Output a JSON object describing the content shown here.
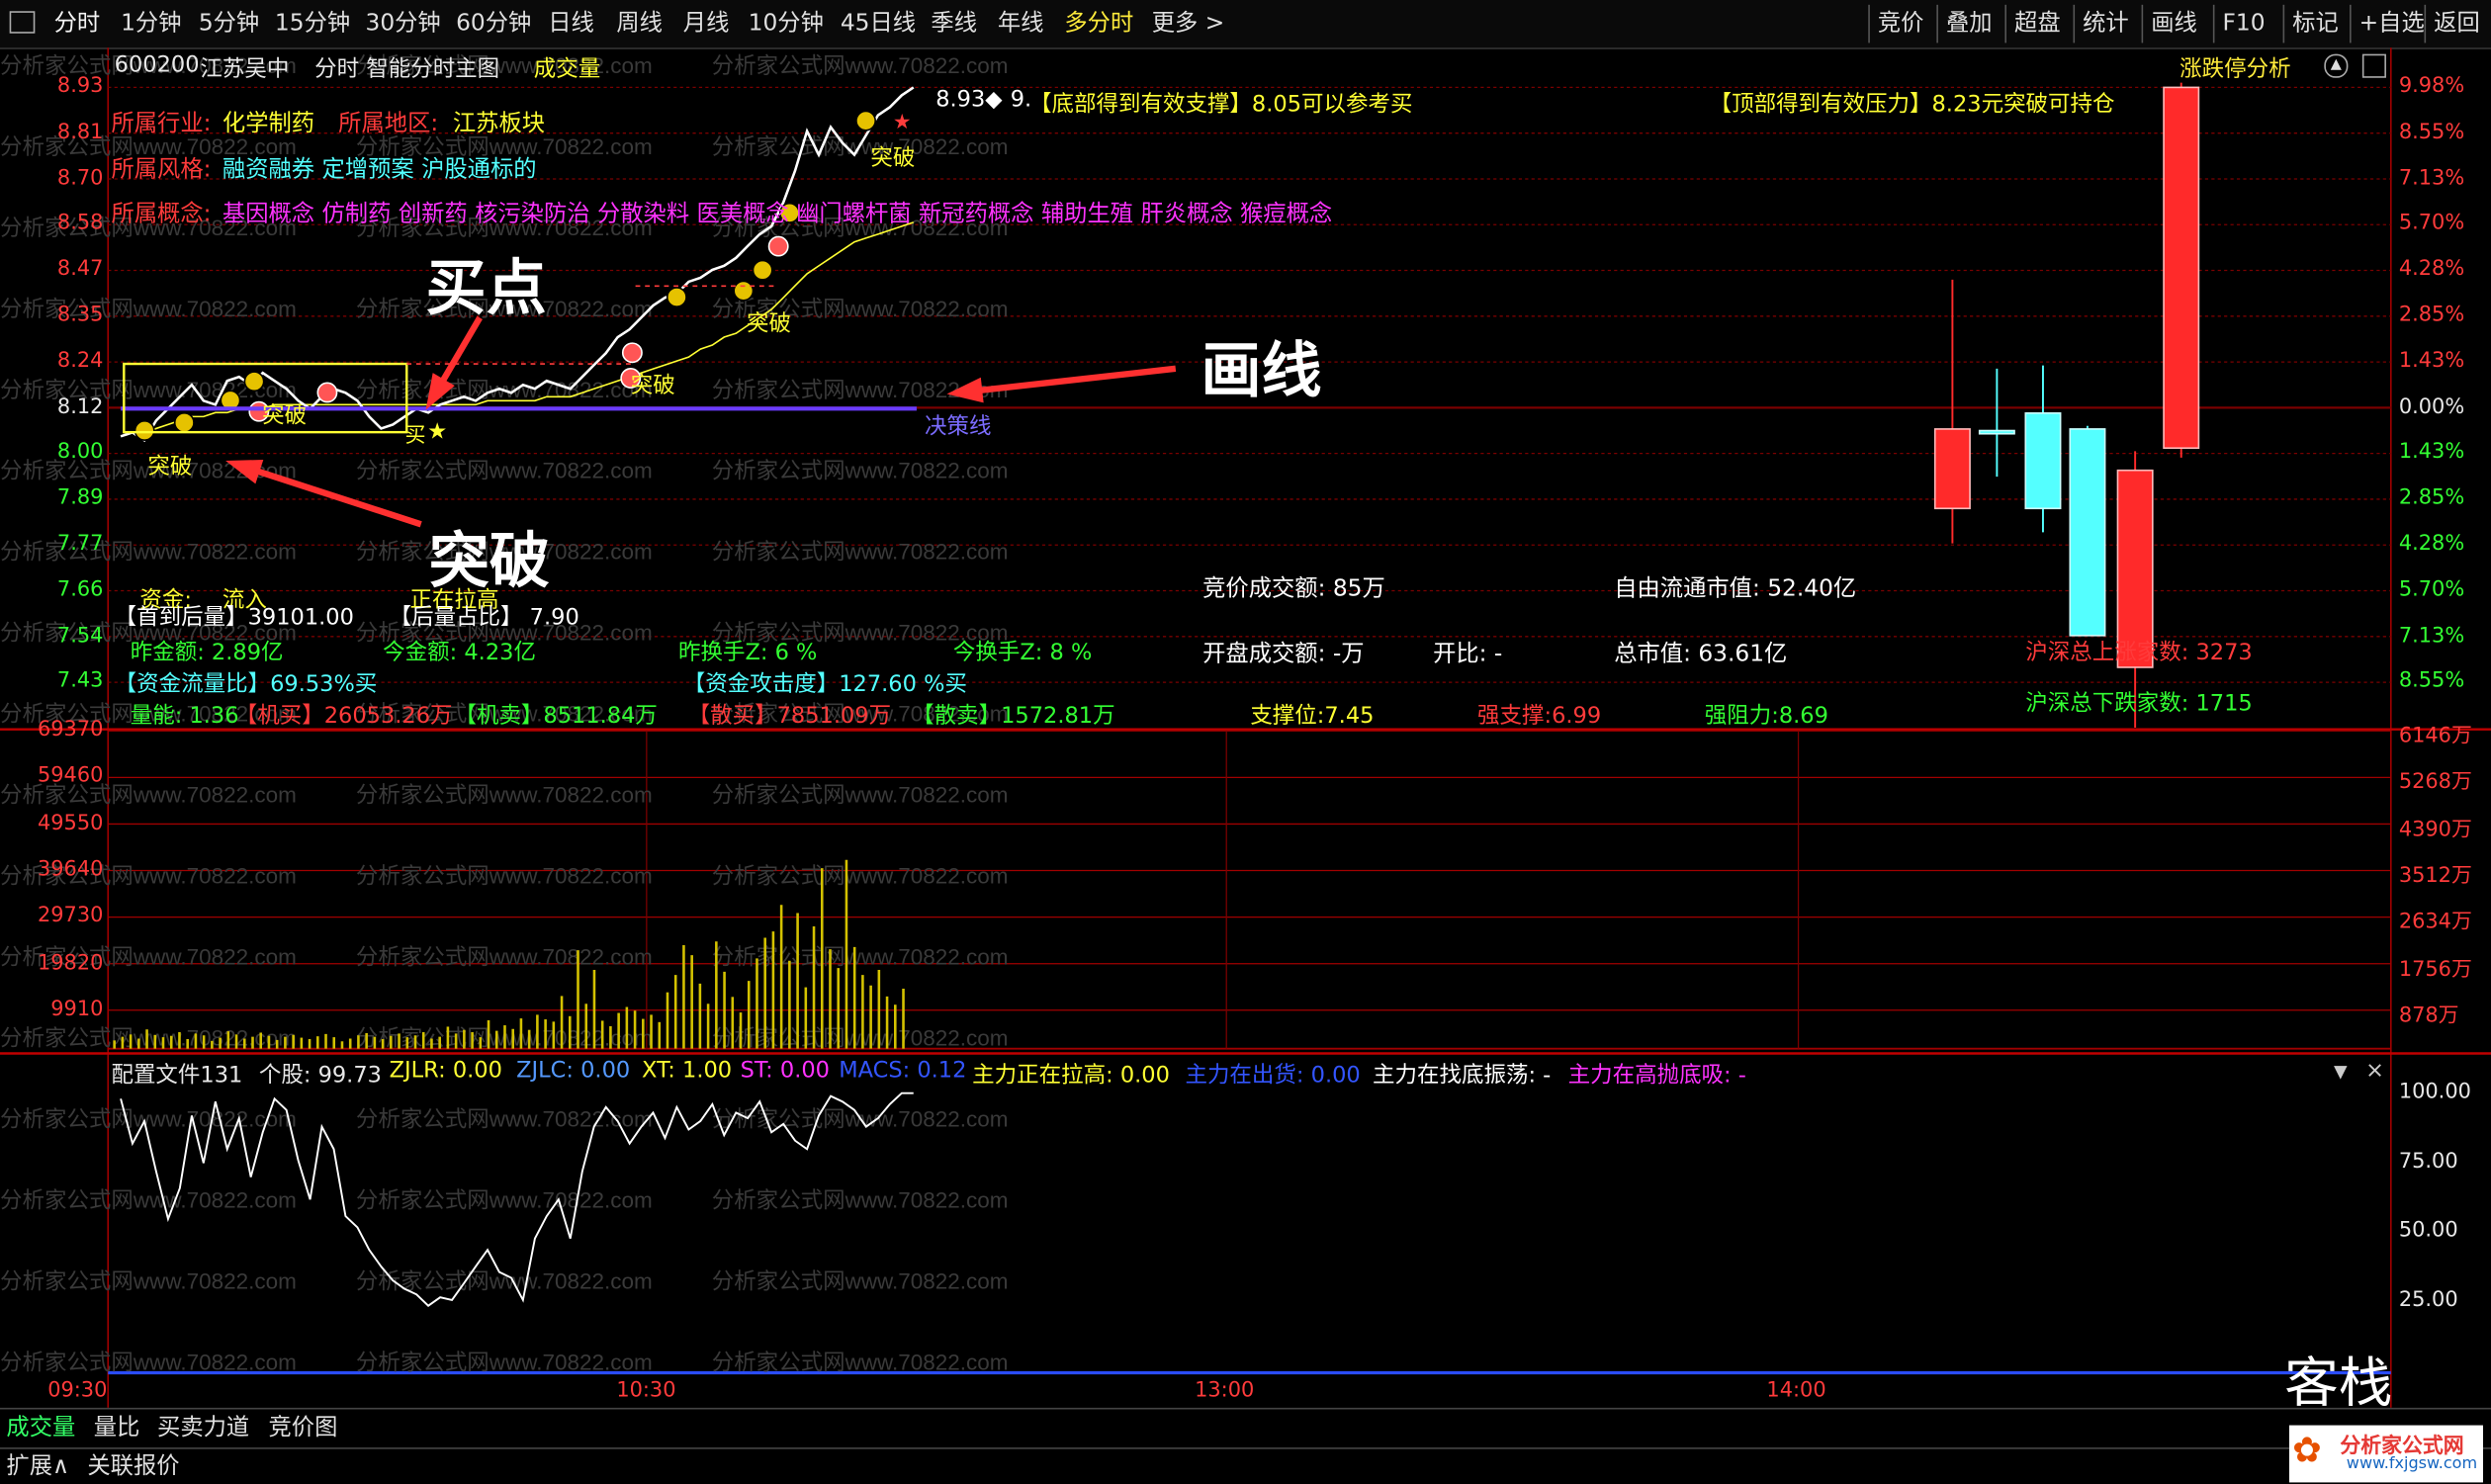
{
  "toolbar": {
    "periods": [
      "分时",
      "1分钟",
      "5分钟",
      "15分钟",
      "30分钟",
      "60分钟",
      "日线",
      "周线",
      "月线",
      "10分钟",
      "45日线",
      "季线",
      "年线",
      "多分时",
      "更多 >"
    ],
    "right_buttons": [
      "竞价",
      "叠加",
      "超盘",
      "统计",
      "画线",
      "F10",
      "标记",
      "+自选",
      "返回"
    ]
  },
  "header": {
    "code": "600200",
    "name": "江苏吴中",
    "chart_title": "分时 智能分时主图",
    "volume_label": "成交量",
    "limit_link": "涨跌停分析"
  },
  "watermark": "分析家公式网www.70822.com",
  "info": {
    "industry_label": "所属行业:",
    "industry": "化学制药",
    "region_label": "所属地区:",
    "region": "江苏板块",
    "style_label": "所属风格:",
    "style": "融资融券 定增预案 沪股通标的",
    "concept_label": "所属概念:",
    "concepts": "基因概念 仿制药 创新药 核污染防治 分散染料 医美概念 幽门螺杆菌 新冠药概念 辅助生殖 肝炎概念 猴痘概念"
  },
  "signals": {
    "price_tag": "8.93◆",
    "price_tag2": "9.",
    "bottom_support": "【底部得到有效支撑】8.05可以参考买",
    "top_pressure": "【顶部得到有效压力】8.23元突破可持仓",
    "breakthrough": "突破",
    "buy_mark": "买",
    "decision_line": "决策线"
  },
  "annotations": {
    "buy_point": "买点",
    "draw_line": "画线",
    "breakout": "突破"
  },
  "stats": {
    "capital_label": "资金:",
    "capital_value": "流入",
    "pulling": "正在拉高",
    "first_volume": "【首到后量】39101.00",
    "after_ratio": "【后量占比】 7.90",
    "yesterday_amount": "昨金额: 2.89亿",
    "today_amount": "今金额: 4.23亿",
    "yesterday_turnover": "昨换手Z: 6 %",
    "today_turnover": "今换手Z: 8 %",
    "flow_ratio": "【资金流量比】69.53%买",
    "attack": "【资金攻击度】127.60 %买",
    "energy": "量能: 1.36",
    "inst_buy": "【机买】26053.26万",
    "inst_sell": "【机卖】8511.84万",
    "retail_buy": "【散买】7851.09万",
    "retail_sell": "【散卖】1572.81万",
    "support": "支撑位:7.45",
    "strong_support": "强支撑:6.99",
    "strong_resist": "强阻力:8.69",
    "auction_volume": "竞价成交额: 85万",
    "open_volume": "开盘成交额: -万",
    "open_ratio": "开比: -",
    "free_cap": "自由流通市值: 52.40亿",
    "total_cap": "总市值: 63.61亿",
    "up_count": "沪深总上涨家数: 3273",
    "down_count": "沪深总下跌家数: 1715"
  },
  "price_axis": {
    "left": [
      "8.93",
      "8.81",
      "8.70",
      "8.58",
      "8.47",
      "8.35",
      "8.24",
      "8.12",
      "8.00",
      "7.89",
      "7.77",
      "7.66",
      "7.54",
      "7.43"
    ],
    "right": [
      "9.98%",
      "8.55%",
      "7.13%",
      "5.70%",
      "4.28%",
      "2.85%",
      "1.43%",
      "0.00%",
      "1.43%",
      "2.85%",
      "4.28%",
      "5.70%",
      "7.13%",
      "8.55%"
    ]
  },
  "volume_axis": {
    "left": [
      "69370",
      "59460",
      "49550",
      "39640",
      "29730",
      "19820",
      "9910"
    ],
    "right": [
      "6146万",
      "5268万",
      "4390万",
      "3512万",
      "2634万",
      "1756万",
      "878万"
    ]
  },
  "indicator": {
    "config": "配置文件131",
    "stock": "个股: 99.73",
    "zjlr": "ZJLR: 0.00",
    "zjlc": "ZJLC: 0.00",
    "xt": "XT: 1.00",
    "st": "ST: 0.00",
    "macs": "MACS: 0.12",
    "pull_up": "主力正在拉高: 0.00",
    "shipping": "主力在出货: 0.00",
    "bottom_shake": "主力在找底振荡: -",
    "top_absorb": "主力在高抛底吸: -",
    "axis": [
      "100.00",
      "75.00",
      "50.00",
      "25.00"
    ]
  },
  "time_axis": [
    "09:30",
    "10:30",
    "13:00",
    "14:00"
  ],
  "bottom_tabs": [
    "成交量",
    "量比",
    "买卖力道",
    "竞价图"
  ],
  "footer_tabs": [
    "扩展∧",
    "关联报价"
  ],
  "logo_text": "分析家公式网",
  "logo_url": "www.fxjgsw.com",
  "corner_text": "客栈",
  "colors": {
    "up": "#ff2a2a",
    "down": "#54ffff",
    "grid": "#a00000",
    "price": "#ffffff",
    "avg": "#ffff33",
    "accent": "#ffeb3b"
  },
  "chart_data": {
    "type": "line",
    "title": "",
    "series": [
      {
        "name": "price",
        "values": [
          8.05,
          8.06,
          8.04,
          8.09,
          8.12,
          8.15,
          8.18,
          8.14,
          8.13,
          8.19,
          8.2,
          8.18,
          8.21,
          8.19,
          8.17,
          8.14,
          8.12,
          8.15,
          8.17,
          8.16,
          8.14,
          8.1,
          8.07,
          8.08,
          8.1,
          8.12,
          8.11,
          8.13,
          8.14,
          8.15,
          8.14,
          8.16,
          8.17,
          8.16,
          8.18,
          8.17,
          8.19,
          8.18,
          8.17,
          8.2,
          8.23,
          8.26,
          8.3,
          8.32,
          8.35,
          8.38,
          8.4,
          8.41,
          8.44,
          8.45,
          8.47,
          8.48,
          8.5,
          8.53,
          8.56,
          8.58,
          8.64,
          8.72,
          8.82,
          8.76,
          8.83,
          8.79,
          8.76,
          8.81,
          8.86,
          8.88,
          8.91,
          8.93
        ]
      },
      {
        "name": "avg",
        "values": [
          8.05,
          8.06,
          8.06,
          8.07,
          8.08,
          8.09,
          8.1,
          8.1,
          8.11,
          8.11,
          8.12,
          8.12,
          8.12,
          8.13,
          8.13,
          8.13,
          8.13,
          8.13,
          8.13,
          8.13,
          8.13,
          8.13,
          8.13,
          8.13,
          8.13,
          8.13,
          8.13,
          8.13,
          8.13,
          8.13,
          8.13,
          8.14,
          8.14,
          8.14,
          8.14,
          8.14,
          8.15,
          8.15,
          8.15,
          8.16,
          8.17,
          8.18,
          8.19,
          8.2,
          8.21,
          8.22,
          8.23,
          8.24,
          8.25,
          8.27,
          8.28,
          8.3,
          8.31,
          8.33,
          8.35,
          8.37,
          8.4,
          8.43,
          8.46,
          8.48,
          8.5,
          8.52,
          8.54,
          8.55,
          8.56,
          8.57,
          8.58,
          8.59
        ]
      }
    ],
    "ylim": [
      7.43,
      8.93
    ],
    "volume": [
      1800,
      2600,
      3100,
      2200,
      4200,
      3000,
      2500,
      2800,
      3600,
      2100,
      3300,
      2900,
      1700,
      2400,
      3800,
      3100,
      2200,
      2600,
      3500,
      2800,
      1900,
      2600,
      3000,
      2400,
      2100,
      2700,
      3200,
      2500,
      1600,
      2200,
      2900,
      3400,
      2600,
      2100,
      2800,
      3300,
      2500,
      2900,
      3600,
      2200,
      2600,
      4800,
      3300,
      4100,
      3600,
      2500,
      6200,
      3900,
      5100,
      4300,
      6600,
      4100,
      7400,
      6400,
      5900,
      11500,
      7100,
      21500,
      9800,
      17200,
      6100,
      4900,
      7800,
      9100,
      8300,
      6500,
      7400,
      5800,
      12300,
      16100,
      22600,
      20400,
      14200,
      9800,
      23400,
      16800,
      11300,
      7900,
      14800,
      19700,
      24200,
      25600,
      31400,
      19200,
      29600,
      13400,
      26700,
      39400,
      21700,
      17600,
      41200,
      22200,
      16100,
      13800,
      17200,
      11400,
      9600,
      13100
    ],
    "indicator": [
      98,
      82,
      90,
      72,
      55,
      66,
      92,
      75,
      97,
      80,
      91,
      70,
      86,
      98,
      94,
      76,
      62,
      88,
      80,
      56,
      52,
      44,
      38,
      33,
      30,
      28,
      24,
      27,
      26,
      32,
      38,
      44,
      36,
      34,
      26,
      48,
      56,
      62,
      48,
      72,
      88,
      95,
      90,
      82,
      88,
      93,
      84,
      95,
      87,
      90,
      96,
      85,
      93,
      91,
      97,
      86,
      89,
      83,
      80,
      92,
      99,
      97,
      94,
      88,
      91,
      96,
      100,
      100
    ]
  }
}
